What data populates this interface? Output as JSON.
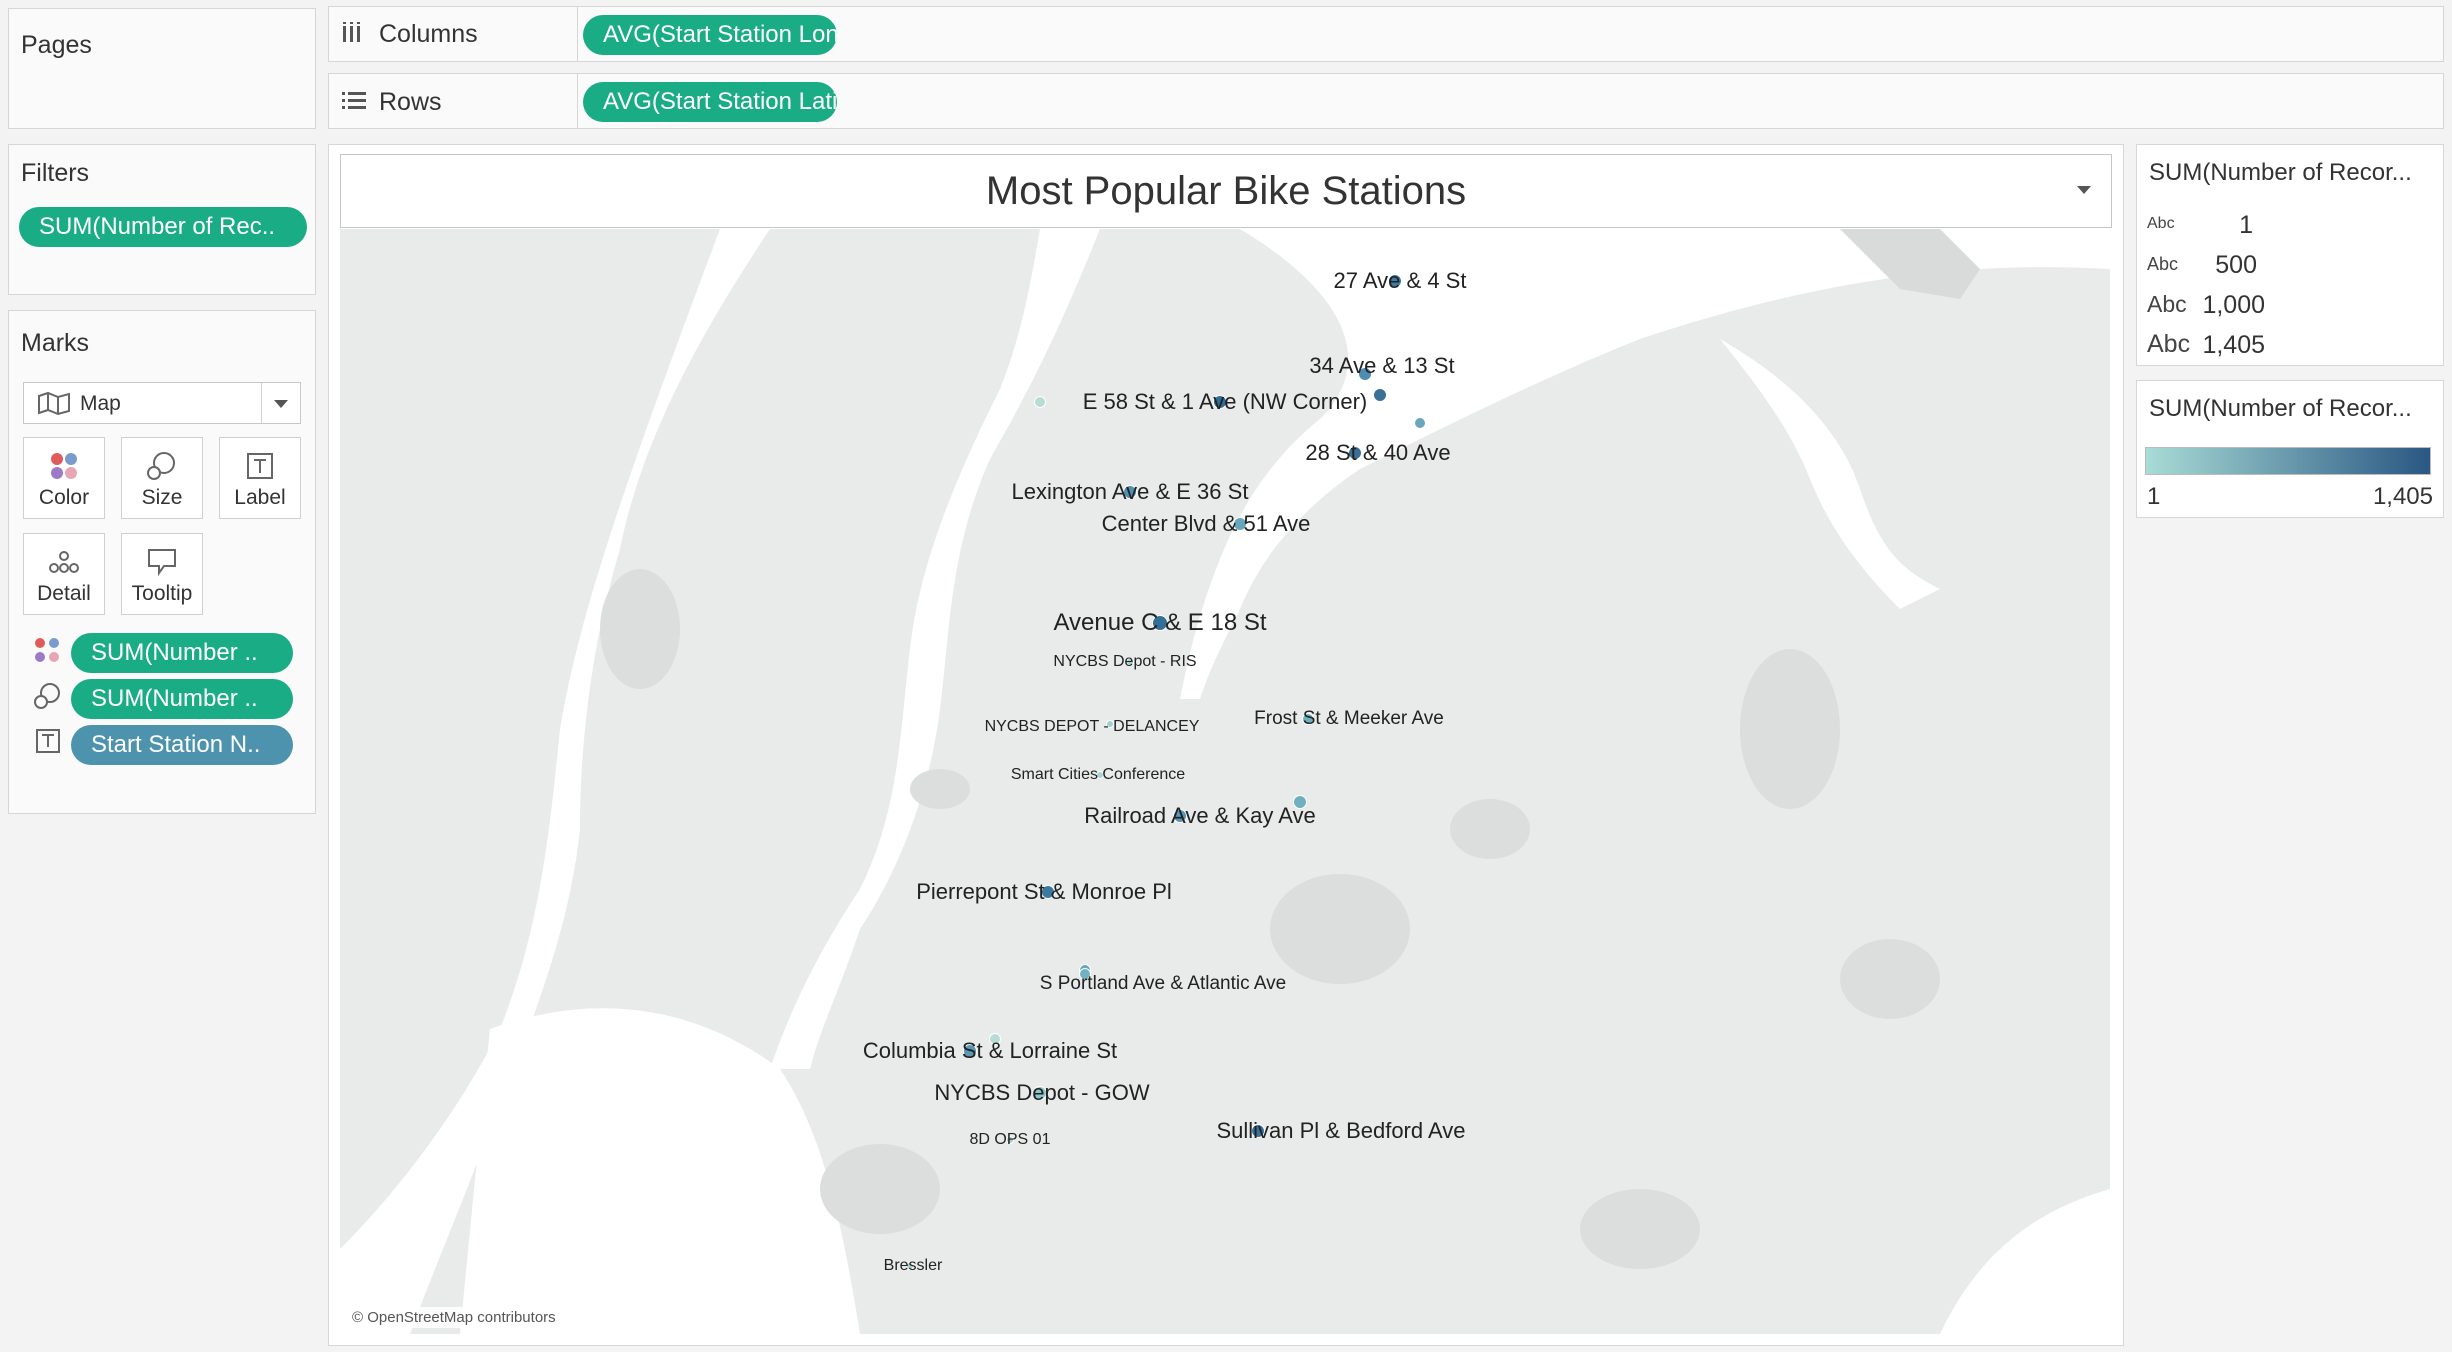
{
  "pages": {
    "title": "Pages"
  },
  "filters": {
    "title": "Filters",
    "pill": "SUM(Number of Rec.."
  },
  "marks": {
    "title": "Marks",
    "type_select": "Map",
    "buttons": {
      "color": "Color",
      "size": "Size",
      "label": "Label",
      "detail": "Detail",
      "tooltip": "Tooltip"
    },
    "pills": {
      "color": "SUM(Number ..",
      "size": "SUM(Number ..",
      "label": "Start Station N.."
    }
  },
  "columns": {
    "label": "Columns",
    "pill": "AVG(Start Station Lon.."
  },
  "rows": {
    "label": "Rows",
    "pill": "AVG(Start Station Lati.."
  },
  "view": {
    "title": "Most Popular Bike Stations",
    "attribution": "© OpenStreetMap contributors"
  },
  "size_legend": {
    "title": "SUM(Number of Recor...",
    "abc": "Abc",
    "items": [
      "1",
      "500",
      "1,000",
      "1,405"
    ]
  },
  "color_legend": {
    "title": "SUM(Number of Recor...",
    "min": "1",
    "max": "1,405",
    "color_low": "#a8dcd6",
    "color_high": "#2a5783"
  },
  "stations": [
    {
      "name": "27 Ave & 4 St",
      "size": "l"
    },
    {
      "name": "34 Ave & 13 St",
      "size": "l"
    },
    {
      "name": "E 58 St &  1 Ave (NW Corner)",
      "size": "l"
    },
    {
      "name": "28 St & 40 Ave",
      "size": "l"
    },
    {
      "name": "Lexington Ave & E 36 St",
      "size": "l"
    },
    {
      "name": "Center Blvd & 51 Ave",
      "size": "l"
    },
    {
      "name": "Avenue C & E 18 St",
      "size": "xl"
    },
    {
      "name": "NYCBS Depot - RIS",
      "size": "s"
    },
    {
      "name": "NYCBS DEPOT - DELANCEY",
      "size": "s"
    },
    {
      "name": "Frost St & Meeker Ave",
      "size": "m"
    },
    {
      "name": "Smart Cities Conference",
      "size": "s"
    },
    {
      "name": "Railroad Ave & Kay Ave",
      "size": "l"
    },
    {
      "name": "Pierrepont St & Monroe Pl",
      "size": "l"
    },
    {
      "name": "S Portland Ave & Atlantic Ave",
      "size": "m"
    },
    {
      "name": "Columbia St & Lorraine St",
      "size": "l"
    },
    {
      "name": "NYCBS Depot - GOW",
      "size": "l"
    },
    {
      "name": "8D OPS 01",
      "size": "s"
    },
    {
      "name": "Sullivan Pl & Bedford Ave",
      "size": "l"
    },
    {
      "name": "Bressler",
      "size": "s"
    }
  ]
}
